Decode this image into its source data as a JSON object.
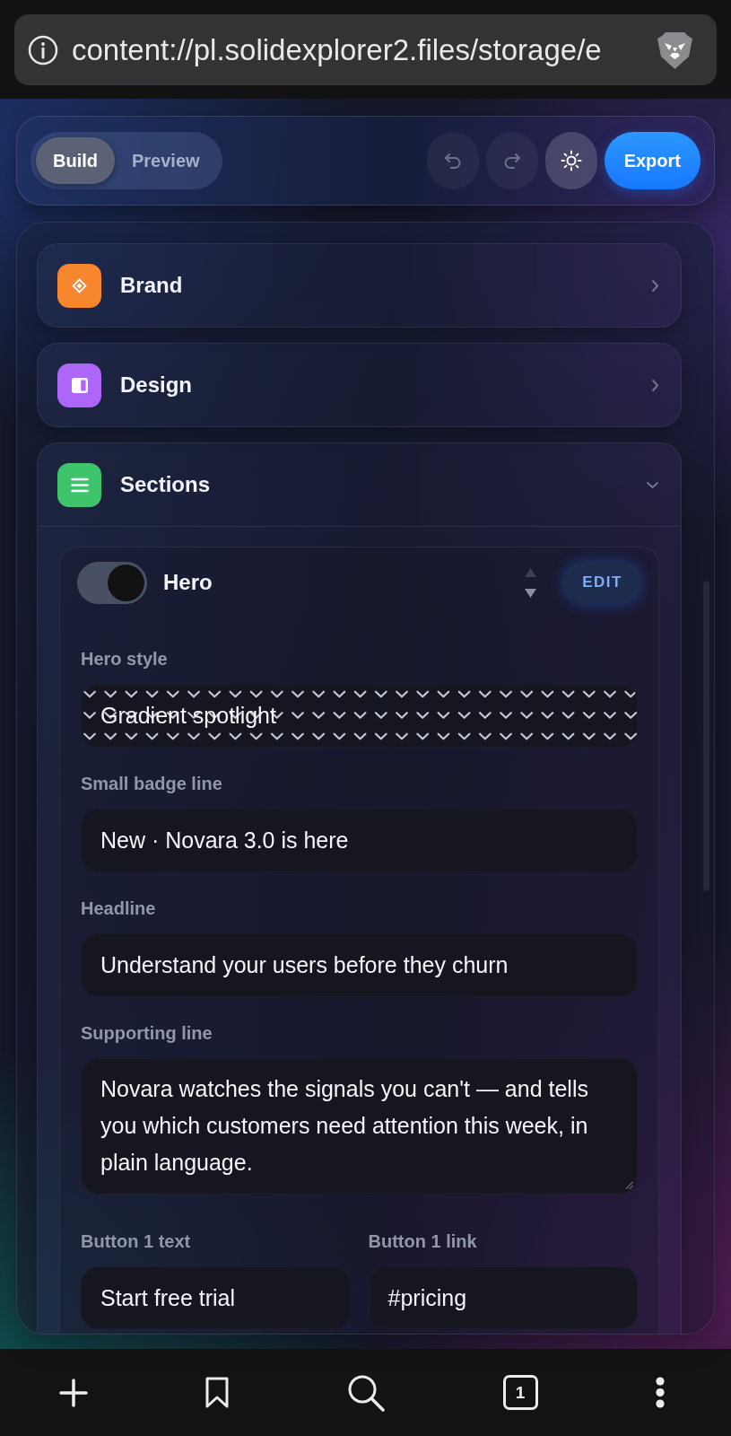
{
  "browser": {
    "url": "content://pl.solidexplorer2.files/storage/e"
  },
  "toolbar": {
    "modes": [
      {
        "label": "Build",
        "selected": true
      },
      {
        "label": "Preview",
        "selected": false
      }
    ],
    "actions": [
      {
        "kind": "undo",
        "disabled": true
      },
      {
        "kind": "redo",
        "disabled": true
      },
      {
        "kind": "theme",
        "disabled": false
      }
    ],
    "export": "Export"
  },
  "groups": [
    {
      "title": "Brand",
      "color": "#f7862c",
      "expanded": false
    },
    {
      "title": "Design",
      "color": "#ad66f7",
      "expanded": false
    },
    {
      "title": "Sections",
      "color": "#3ec46b",
      "expanded": true,
      "items": [
        {
          "title": "Hero",
          "on": true,
          "move_up": {
            "disabled": true
          },
          "move_down": {
            "disabled": false
          },
          "edit": "EDIT",
          "fields": [
            {
              "kind": "select",
              "label": "Hero style",
              "value": "Gradient spotlight"
            },
            {
              "kind": "input",
              "label": "Small badge line",
              "value": "New · Novara 3.0 is here"
            },
            {
              "kind": "input",
              "label": "Headline",
              "value": "Understand your users before they churn"
            },
            {
              "kind": "textarea",
              "label": "Supporting line",
              "value": "Novara watches the signals you can't — and tells you which customers need attention this week, in plain language."
            },
            {
              "kind": "pair",
              "fields": [
                {
                  "kind": "input",
                  "label": "Button 1 text",
                  "value": "Start free trial"
                },
                {
                  "kind": "input",
                  "label": "Button 1 link",
                  "value": "#pricing"
                }
              ]
            }
          ]
        }
      ]
    }
  ],
  "bottom_bar": {
    "tab_count": "1"
  }
}
